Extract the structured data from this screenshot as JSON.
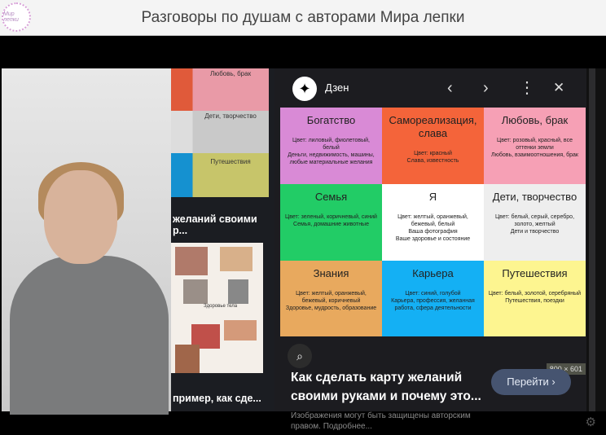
{
  "header": {
    "title": "Разговоры по душам с авторами Мира лепки",
    "logo_text": "Мир лепки"
  },
  "middle": {
    "thumb1_caption": "желаний своими р...",
    "thumb2_caption": "пример, как сде...",
    "thumb1_labels": [
      "Любовь, брак",
      "Дети, творчество",
      "Путешествия"
    ],
    "collage_text": "Здоровье тела"
  },
  "panel": {
    "brand": "Дзен",
    "prev": "‹",
    "next": "›",
    "more": "⋮",
    "close": "✕",
    "cells": [
      {
        "title": "Богатство",
        "text": "Цвет: лиловый, фиолетовый, белый\nДеньги, недвижимость, машины, любые материальные желания",
        "color": "#d98ad6"
      },
      {
        "title": "Самореализация, слава",
        "text": "Цвет: красный\nСлава, известность",
        "color": "#f4643a"
      },
      {
        "title": "Любовь, брак",
        "text": "Цвет: розовый, красный, все оттенки земли\nЛюбовь, взаимоотношения, брак",
        "color": "#f6a0b5"
      },
      {
        "title": "Семья",
        "text": "Цвет: зеленый, коричневый, синий\nСемья, домашние животные",
        "color": "#22cc66"
      },
      {
        "title": "Я",
        "text": "Цвет: желтый, оранжевый, бежевый, белый\nВаша фотография\nВаше здоровье и состояние",
        "color": "#ffffff"
      },
      {
        "title": "Дети, творчество",
        "text": "Цвет: белый, серый, серебро, золото, желтый\nДети и творчество",
        "color": "#eeeeee"
      },
      {
        "title": "Знания",
        "text": "Цвет: желтый, оранжевый, бежевый, коричневый\nЗдоровье, мудрость, образование",
        "color": "#e8a95e"
      },
      {
        "title": "Карьера",
        "text": "Цвет: синий, голубой\nКарьера, профессия, желанная работа, сфера деятельности",
        "color": "#14b0f4"
      },
      {
        "title": "Путешествия",
        "text": "Цвет: белый, золотой, серебряный\nПутешествия, поездки",
        "color": "#fdf590"
      }
    ],
    "dims": "800 × 601",
    "title": "Как сделать карту желаний своими руками и почему это...",
    "go_label": "Перейти ›",
    "note": "Изображения могут быть защищены авторским правом. Подробнее..."
  }
}
